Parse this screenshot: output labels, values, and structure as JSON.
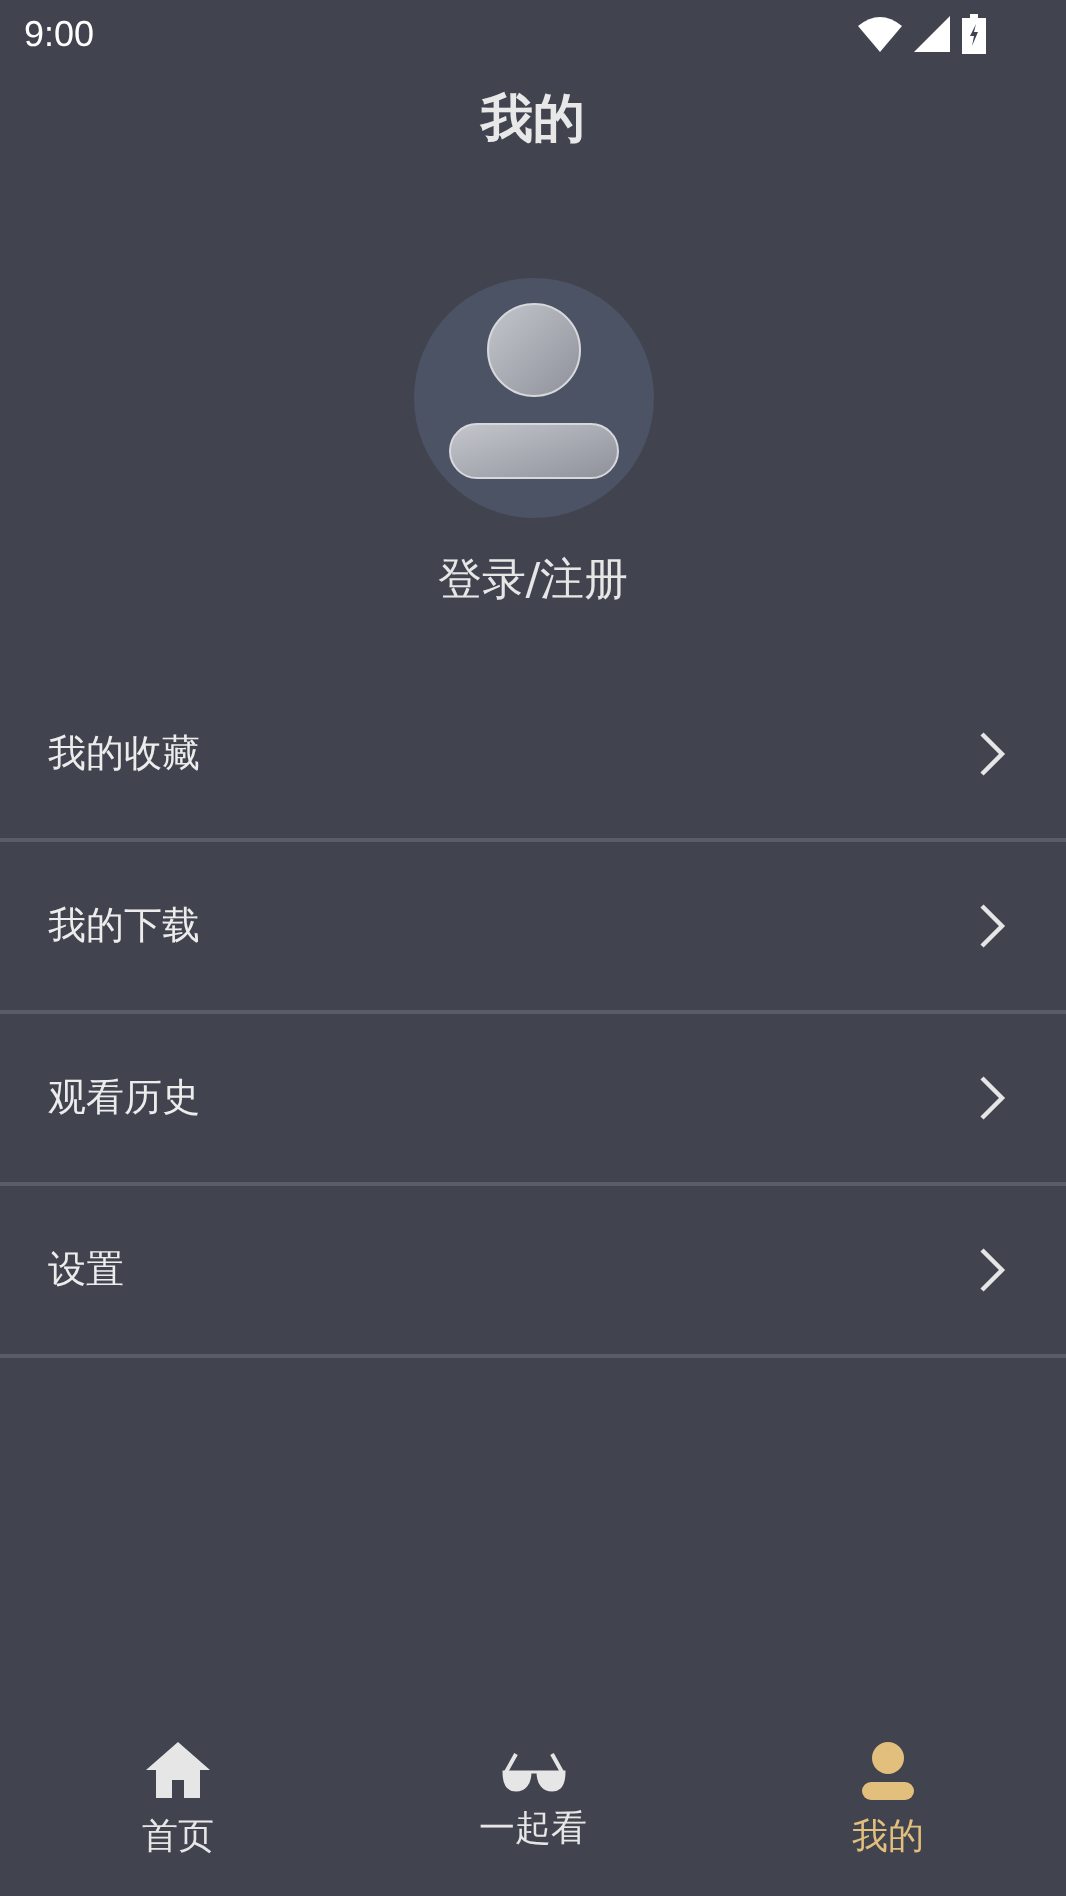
{
  "status_bar": {
    "time": "9:00"
  },
  "header": {
    "title": "我的"
  },
  "profile": {
    "login_label": "登录/注册"
  },
  "menu": [
    {
      "label": "我的收藏"
    },
    {
      "label": "我的下载"
    },
    {
      "label": "观看历史"
    },
    {
      "label": "设置"
    }
  ],
  "tab_bar": [
    {
      "kind": "home",
      "label": "首页",
      "selected": false
    },
    {
      "kind": "glasses",
      "label": "一起看",
      "selected": false
    },
    {
      "kind": "person",
      "label": "我的",
      "selected": true
    }
  ]
}
